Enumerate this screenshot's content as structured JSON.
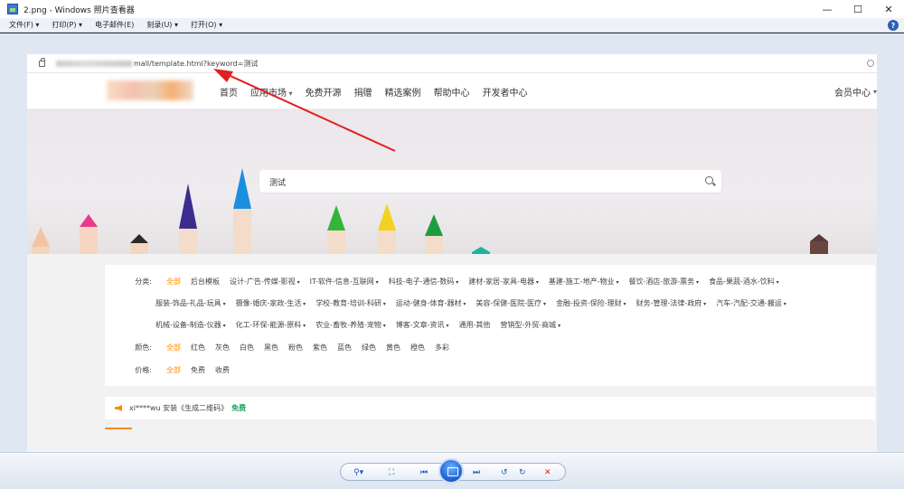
{
  "window": {
    "title": "2.png - Windows 照片查看器",
    "controls": [
      "—",
      "☐",
      "✕"
    ]
  },
  "menu": {
    "items": [
      "文件(F) ▾",
      "打印(P) ▾",
      "电子邮件(E)",
      "刻录(U) ▾",
      "打开(O) ▾"
    ],
    "help": "?"
  },
  "screenshot": {
    "address": {
      "url": "mall/template.html?keyword=测试"
    },
    "nav": {
      "links": [
        "首页",
        "应用市场",
        "免费开源",
        "捐赠",
        "精选案例",
        "帮助中心",
        "开发者中心"
      ],
      "member": "会员中心"
    },
    "search": {
      "query": "测试"
    },
    "filters": {
      "category_label": "分类:",
      "category_row1": [
        "全部",
        "后台模板",
        "设计-广告-传媒-影视",
        "IT-软件-信息-互联网",
        "科技-电子-通信-数码",
        "建材-家居-家具-电器",
        "基建-施工-地产-物业",
        "餐饮-酒店-旅游-票务",
        "食品-果蔬-酒水-饮料"
      ],
      "category_row2": [
        "服装-饰品-礼品-玩具",
        "摄像-婚庆-家政-生活",
        "学校-教育-培训-科研",
        "运动-健身-体育-器材",
        "美容-保健-医院-医疗",
        "金融-投资-保险-理财",
        "财务-管理-法律-政府",
        "汽车-汽配-交通-搬运"
      ],
      "category_row3": [
        "机械-设备-制造-仪器",
        "化工-环保-能源-原料",
        "农业-畜牧-养殖-宠物",
        "博客-文章-资讯",
        "通用-其他",
        "营销型-外贸-商城"
      ],
      "color_label": "颜色:",
      "colors": [
        "全部",
        "红色",
        "灰色",
        "白色",
        "黑色",
        "粉色",
        "紫色",
        "蓝色",
        "绿色",
        "黄色",
        "橙色",
        "多彩"
      ],
      "price_label": "价格:",
      "prices": [
        "全部",
        "免费",
        "收费"
      ]
    },
    "notice": {
      "text": "xi****wu 安装《生成二维码》",
      "tag": "免费"
    }
  },
  "toolbar": {
    "zoom": "⚲▾",
    "fit": "⛶",
    "prev": "⏮",
    "next": "⏭",
    "rotate_ccw": "↺",
    "rotate_cw": "↻",
    "delete": "✕"
  },
  "colors": {
    "accent": "#ff8a00",
    "free": "#19a15f",
    "arrow": "#e02020"
  }
}
